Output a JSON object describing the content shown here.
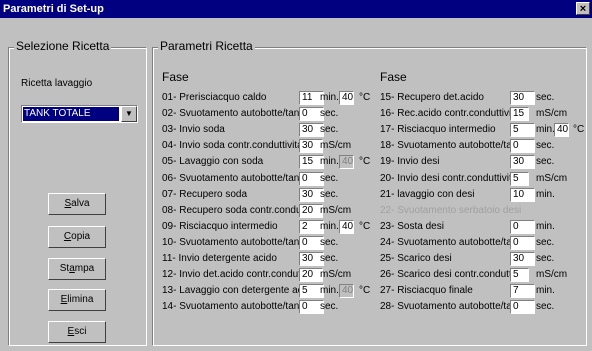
{
  "window": {
    "title": "Parametri di Set-up",
    "close_glyph": "×"
  },
  "selezione": {
    "title": "Selezione Ricetta",
    "label": "Ricetta lavaggio",
    "selected": "TANK TOTALE",
    "buttons": [
      {
        "first": "S",
        "rest": "alva"
      },
      {
        "first": "C",
        "rest": "opia"
      },
      {
        "pre": "St",
        "first": "a",
        "rest": "mpa"
      },
      {
        "first": "E",
        "rest": "limina"
      },
      {
        "first": "E",
        "rest": "sci"
      }
    ]
  },
  "parametri": {
    "title": "Parametri Ricetta",
    "left_header": "Fase",
    "right_header": "Fase",
    "left": [
      {
        "name": "01- Prerisciacquo caldo",
        "v1": "11",
        "u1": "min.",
        "v2": "40",
        "u2": "°C"
      },
      {
        "name": "02- Svuotamento autobotte/tank",
        "v1": "0",
        "u1": "sec."
      },
      {
        "name": "03- Invio soda",
        "v1": "30",
        "u1": "sec."
      },
      {
        "name": "04- Invio soda contr.conduttivita'",
        "v1": "30",
        "u1": "mS/cm"
      },
      {
        "name": "05- Lavaggio con soda",
        "v1": "15",
        "u1": "min.",
        "v2": "40",
        "u2": "°C",
        "v2_disabled": true
      },
      {
        "name": "06- Svuotamento autobotte/tank",
        "v1": "0",
        "u1": "sec."
      },
      {
        "name": "07- Recupero soda",
        "v1": "30",
        "u1": "sec."
      },
      {
        "name": "08- Recupero soda contr.condutt.",
        "v1": "20",
        "u1": "mS/cm"
      },
      {
        "name": "09- Risciacquo intermedio",
        "v1": "2",
        "u1": "min.",
        "v2": "40",
        "u2": "°C"
      },
      {
        "name": "10- Svuotamento autobotte/tank",
        "v1": "0",
        "u1": "sec."
      },
      {
        "name": "11- Invio detergente acido",
        "v1": "30",
        "u1": "sec."
      },
      {
        "name": "12- Invio det.acido contr.condutt.",
        "v1": "20",
        "u1": "mS/cm"
      },
      {
        "name": "13- Lavaggio con detergente acido",
        "v1": "5",
        "u1": "min.",
        "v2": "40",
        "u2": "°C",
        "v2_disabled": true
      },
      {
        "name": "14- Svuotamento autobotte/tank",
        "v1": "0",
        "u1": "sec."
      }
    ],
    "right": [
      {
        "name": "15- Recupero det.acido",
        "v1": "30",
        "u1": "sec."
      },
      {
        "name": "16- Rec.acido contr.conduttivita'",
        "v1": "15",
        "u1": "mS/cm"
      },
      {
        "name": "17- Risciacquo intermedio",
        "v1": "5",
        "u1": "min.",
        "v2": "40",
        "u2": "°C"
      },
      {
        "name": "18- Svuotamento autobotte/tank",
        "v1": "0",
        "u1": "sec."
      },
      {
        "name": "19- Invio desi",
        "v1": "30",
        "u1": "sec."
      },
      {
        "name": "20- Invio desi contr.conduttivita'",
        "v1": "5",
        "u1": "mS/cm"
      },
      {
        "name": "21- lavaggio con desi",
        "v1": "10",
        "u1": "min."
      },
      {
        "name": "22- Svuotamento serbatoio desi",
        "disabled": true
      },
      {
        "name": "23- Sosta desi",
        "v1": "0",
        "u1": "min."
      },
      {
        "name": "24- Svuotamento autobotte/tank",
        "v1": "0",
        "u1": "sec."
      },
      {
        "name": "25- Scarico desi",
        "v1": "30",
        "u1": "sec."
      },
      {
        "name": "26- Scarico desi contr.condutt.",
        "v1": "5",
        "u1": "mS/cm"
      },
      {
        "name": "27- Risciacquo finale",
        "v1": "7",
        "u1": "min."
      },
      {
        "name": "28- Svuotamento autobotte/tank",
        "v1": "0",
        "u1": "sec."
      }
    ]
  }
}
